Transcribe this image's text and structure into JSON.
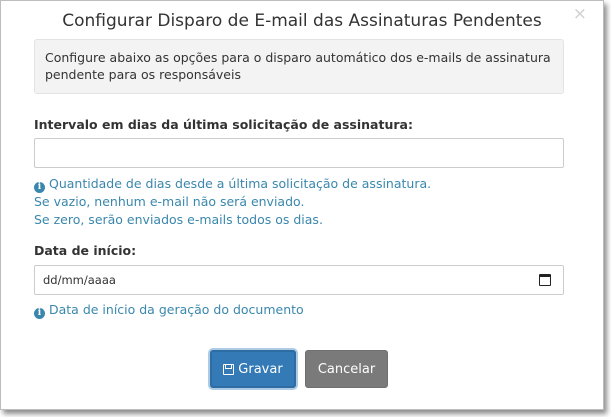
{
  "dialog": {
    "title": "Configurar Disparo de E-mail das Assinaturas Pendentes",
    "close_glyph": "×",
    "info": "Configure abaixo as opções para o disparo automático dos e-mails de assinatura pendente para os responsáveis"
  },
  "interval_field": {
    "label": "Intervalo em dias da última solicitação de assinatura:",
    "value": "",
    "help_line1": "Quantidade de dias desde a última solicitação de assinatura.",
    "help_line2": "Se vazio, nenhum e-mail não será enviado.",
    "help_line3": "Se zero, serão enviados e-mails todos os dias."
  },
  "date_field": {
    "label": "Data de início:",
    "placeholder": "dd/mm/aaaa",
    "help": "Data de início da geração do documento"
  },
  "buttons": {
    "save": "Gravar",
    "cancel": "Cancelar"
  },
  "icons": {
    "info": "info-circle-icon",
    "save": "floppy-disk-icon",
    "calendar": "calendar-icon",
    "close": "close-icon"
  },
  "colors": {
    "primary": "#337ab7",
    "help_text": "#3a87ad",
    "cancel": "#7a7a7a"
  }
}
